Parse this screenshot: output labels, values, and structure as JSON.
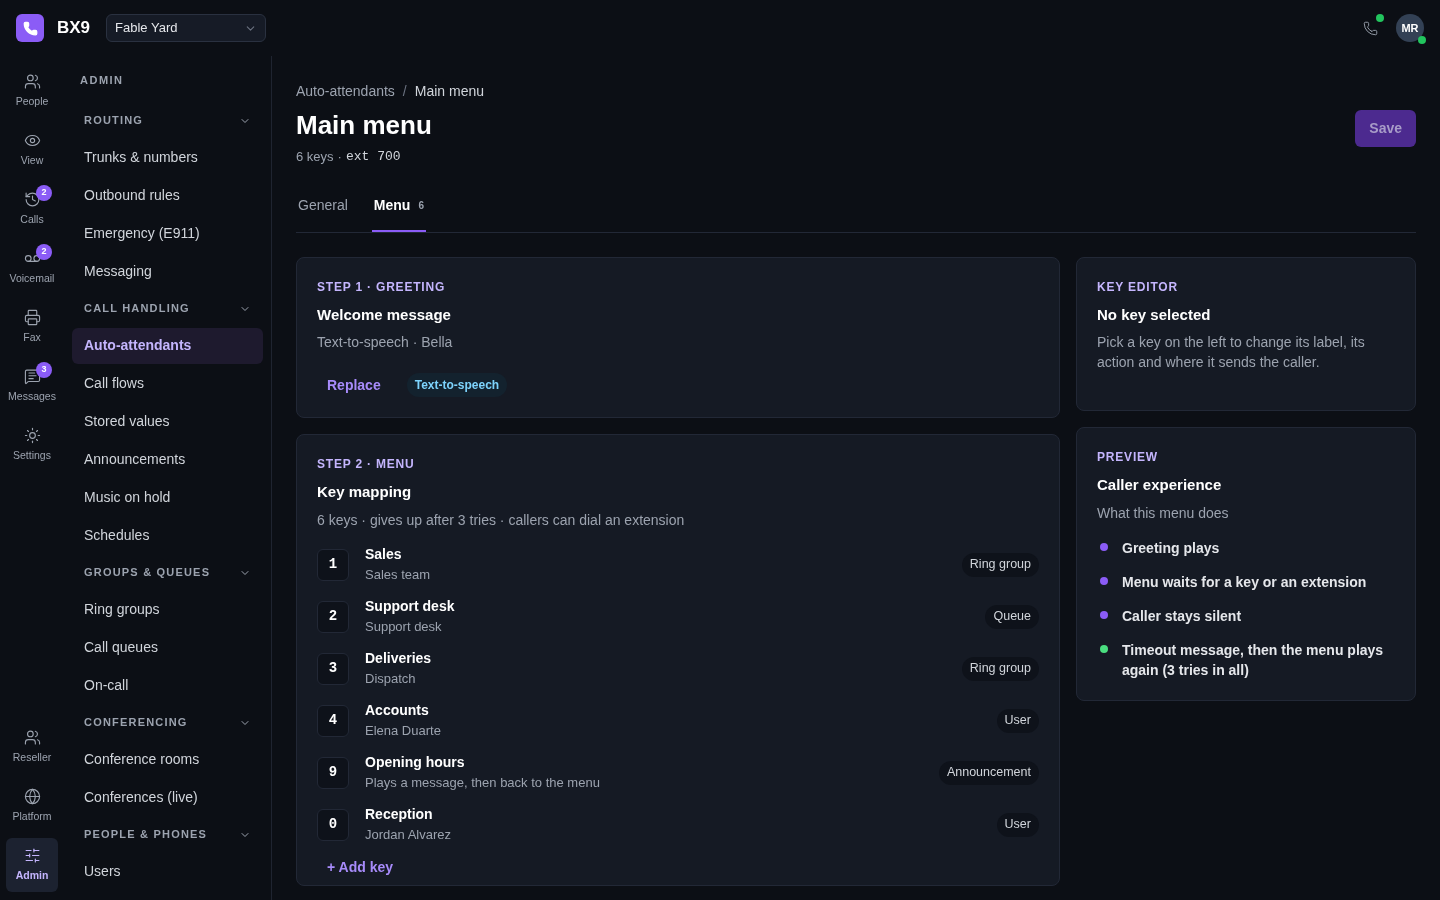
{
  "brand": {
    "name": "BX9",
    "workspace": "Fable Yard"
  },
  "user": {
    "initials": "MR"
  },
  "rail": {
    "top": [
      {
        "label": "People",
        "selected": false
      },
      {
        "label": "View",
        "selected": false
      },
      {
        "label": "Calls",
        "badge": "2",
        "selected": false
      },
      {
        "label": "Voicemail",
        "badge": "2",
        "selected": false
      },
      {
        "label": "Fax",
        "selected": false
      },
      {
        "label": "Messages",
        "badge": "3",
        "selected": false
      },
      {
        "label": "Settings",
        "selected": false
      }
    ],
    "bottom": [
      {
        "label": "Reseller",
        "selected": false
      },
      {
        "label": "Platform",
        "selected": false
      },
      {
        "label": "Admin",
        "selected": true
      }
    ]
  },
  "nav": {
    "title": "ADMIN",
    "sections": [
      {
        "title": "ROUTING",
        "expanded": true,
        "items": [
          {
            "label": "Trunks & numbers",
            "selected": false
          },
          {
            "label": "Outbound rules",
            "selected": false
          },
          {
            "label": "Emergency (E911)",
            "selected": false
          },
          {
            "label": "Messaging",
            "selected": false
          }
        ]
      },
      {
        "title": "CALL HANDLING",
        "expanded": true,
        "items": [
          {
            "label": "Auto-attendants",
            "selected": true
          },
          {
            "label": "Call flows",
            "selected": false
          },
          {
            "label": "Stored values",
            "selected": false
          },
          {
            "label": "Announcements",
            "selected": false
          },
          {
            "label": "Music on hold",
            "selected": false
          },
          {
            "label": "Schedules",
            "selected": false
          }
        ]
      },
      {
        "title": "GROUPS & QUEUES",
        "expanded": true,
        "items": [
          {
            "label": "Ring groups",
            "selected": false
          },
          {
            "label": "Call queues",
            "selected": false
          },
          {
            "label": "On-call",
            "selected": false
          }
        ]
      },
      {
        "title": "CONFERENCING",
        "expanded": true,
        "items": [
          {
            "label": "Conference rooms",
            "selected": false
          },
          {
            "label": "Conferences (live)",
            "selected": false
          }
        ]
      },
      {
        "title": "PEOPLE & PHONES",
        "expanded": true,
        "items": [
          {
            "label": "Users",
            "selected": false
          }
        ]
      }
    ]
  },
  "breadcrumb": {
    "parent": "Auto-attendants",
    "separator": "/",
    "current": "Main menu"
  },
  "page": {
    "title": "Main menu",
    "meta": "6 keys",
    "separator": "·",
    "ext": "ext 700",
    "save": {
      "label": "Save",
      "disabled": true
    }
  },
  "tabs": [
    {
      "label": "General",
      "selected": false
    },
    {
      "label": "Menu",
      "count": "6",
      "selected": true
    }
  ],
  "greeting": {
    "step": "STEP 1 · GREETING",
    "title": "Welcome message",
    "subtitle": "Text-to-speech · Bella",
    "action": "Replace",
    "tag": "Text-to-speech"
  },
  "menu": {
    "step": "STEP 2 · MENU",
    "title": "Key mapping",
    "subtitle": "6 keys · gives up after 3 tries · callers can dial an extension",
    "add": "+ Add key",
    "keys": [
      {
        "key": "1",
        "name": "Sales",
        "target": "Sales team",
        "type": "Ring group"
      },
      {
        "key": "2",
        "name": "Support desk",
        "target": "Support desk",
        "type": "Queue"
      },
      {
        "key": "3",
        "name": "Deliveries",
        "target": "Dispatch",
        "type": "Ring group"
      },
      {
        "key": "4",
        "name": "Accounts",
        "target": "Elena Duarte",
        "type": "User"
      },
      {
        "key": "9",
        "name": "Opening hours",
        "target": "Plays a message, then back to the menu",
        "type": "Announcement"
      },
      {
        "key": "0",
        "name": "Reception",
        "target": "Jordan Alvarez",
        "type": "User"
      }
    ]
  },
  "key_editor": {
    "eyebrow": "KEY EDITOR",
    "title": "No key selected",
    "text": "Pick a key on the left to change its label, its action and where it sends the caller."
  },
  "preview": {
    "eyebrow": "PREVIEW",
    "title": "Caller experience",
    "subtitle": "What this menu does",
    "steps": [
      {
        "text": "Greeting plays",
        "color": "#8b5cf6"
      },
      {
        "text": "Menu waits for a key or an extension",
        "color": "#8b5cf6"
      },
      {
        "text": "Caller stays silent",
        "color": "#8b5cf6"
      },
      {
        "text": "Timeout message, then the menu plays again (3 tries in all)",
        "color": "#4ade80"
      }
    ]
  }
}
